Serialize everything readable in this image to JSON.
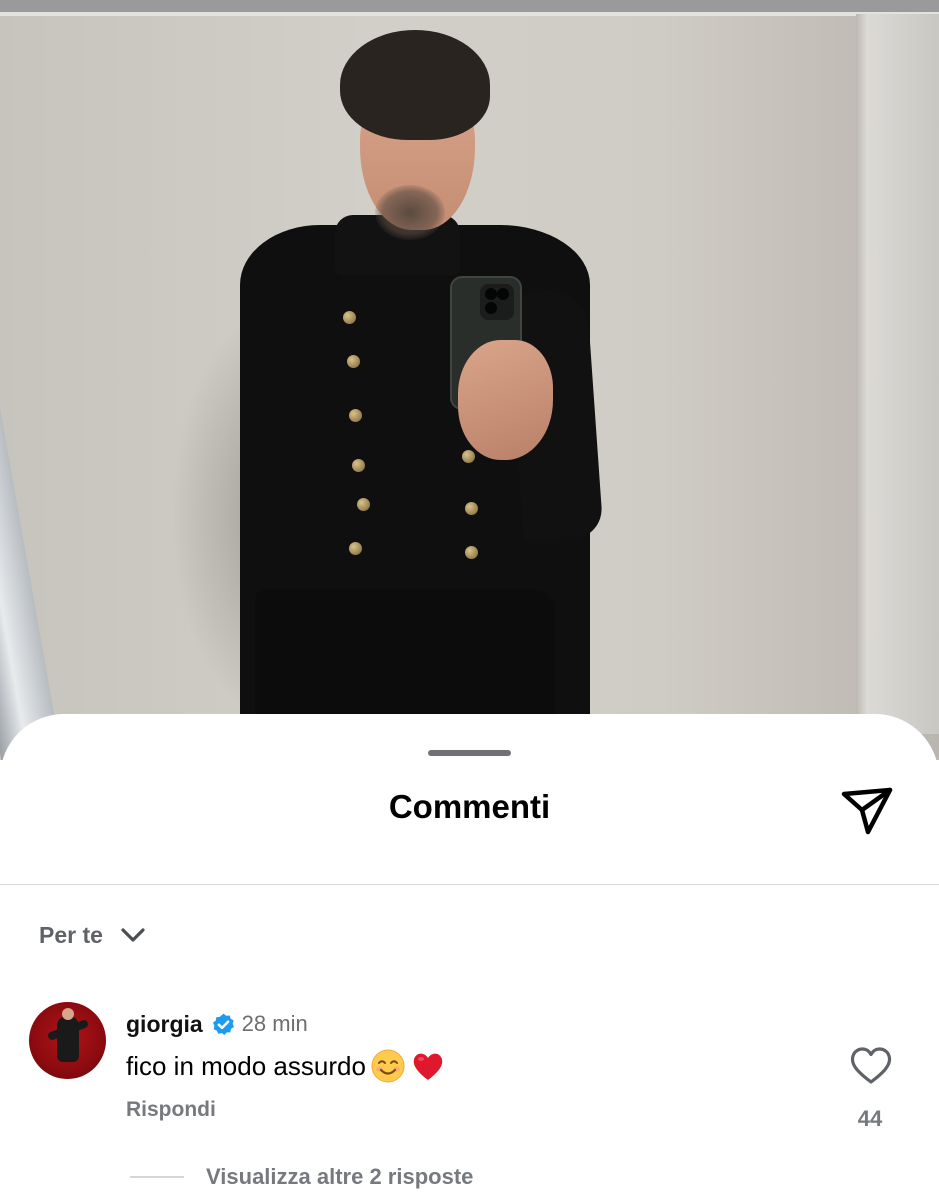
{
  "sheet": {
    "title": "Commenti",
    "share_icon": "send-icon"
  },
  "sort": {
    "label": "Per te",
    "icon": "chevron-down-icon"
  },
  "comment": {
    "username": "giorgia",
    "verified": true,
    "time": "28 min",
    "text": "fico in modo assurdo",
    "emojis": [
      "smiling-face-emoji",
      "red-heart-emoji"
    ],
    "reply_label": "Rispondi",
    "like_count": "44",
    "like_icon": "heart-icon"
  },
  "replies": {
    "label": "Visualizza altre 2 risposte"
  },
  "colors": {
    "verified_badge": "#1d9bf0",
    "heart_emoji": "#e0182d",
    "secondary_text": "#76797d"
  }
}
